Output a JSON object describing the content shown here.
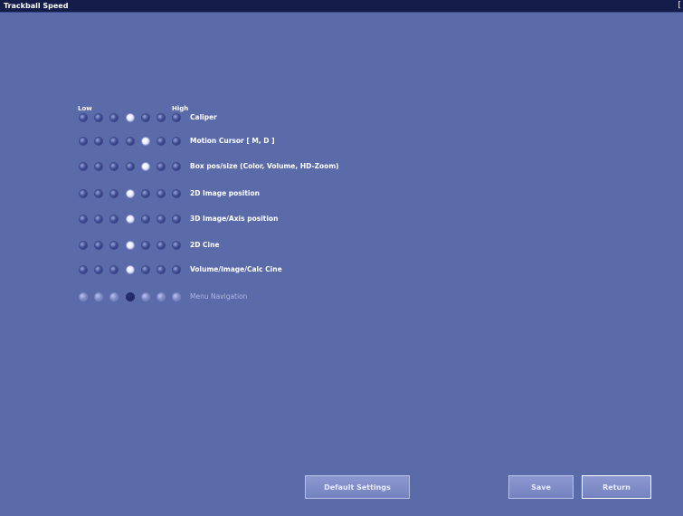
{
  "window": {
    "title": "Trackball Speed",
    "close_label": "["
  },
  "scale": {
    "low": "Low",
    "high": "High"
  },
  "rows": [
    {
      "label": "Caliper",
      "selected": 3,
      "dim": false
    },
    {
      "label": "Motion Cursor [ M, D ]",
      "selected": 4,
      "dim": false
    },
    {
      "label": "Box pos/size (Color, Volume, HD-Zoom)",
      "selected": 4,
      "dim": false
    },
    {
      "label": "2D Image position",
      "selected": 3,
      "dim": false
    },
    {
      "label": "3D Image/Axis position",
      "selected": 3,
      "dim": false
    },
    {
      "label": "2D Cine",
      "selected": 3,
      "dim": false
    },
    {
      "label": "Volume/Image/Calc Cine",
      "selected": 3,
      "dim": false
    },
    {
      "label": "Menu Navigation",
      "selected": 3,
      "dim": true
    }
  ],
  "radio_count": 7,
  "buttons": {
    "default_settings": "Default Settings",
    "save": "Save",
    "return": "Return"
  },
  "colors": {
    "background": "#5b6aa9",
    "titlebar": "#141c4a",
    "button": "#7f8cc8"
  }
}
